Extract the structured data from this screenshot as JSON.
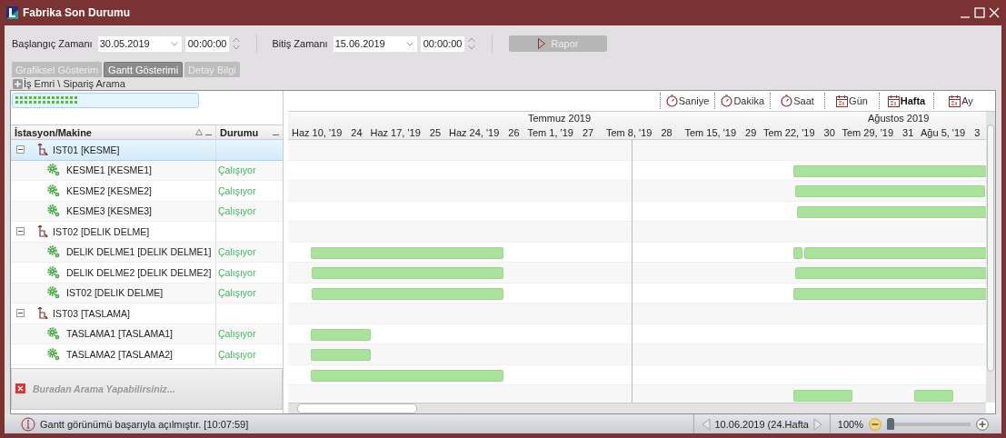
{
  "window": {
    "title": "Fabrika Son Durumu"
  },
  "filters": {
    "start_label": "Başlangıç Zamanı",
    "start_date": "30.05.2019",
    "start_time": "00:00:00",
    "end_label": "Bitiş Zamanı",
    "end_date": "15.06.2019",
    "end_time": "00:00:00",
    "report_button": "Rapor",
    "report_disabled": true
  },
  "tabs": [
    {
      "label": "Grafiksel Gösterim",
      "selected": false
    },
    {
      "label": "Gantt Gösterimi",
      "selected": true
    },
    {
      "label": "Detay Bilgi",
      "selected": false
    }
  ],
  "search_toggle": {
    "label": "İş Emri \\ Sipariş Arama",
    "expanded": false
  },
  "scale_buttons": [
    {
      "label": "Saniye",
      "kind": "clock",
      "selected": false
    },
    {
      "label": "Dakika",
      "kind": "clock",
      "selected": false
    },
    {
      "label": "Saat",
      "kind": "clock",
      "selected": false
    },
    {
      "label": "Gün",
      "kind": "calendar",
      "selected": false
    },
    {
      "label": "Hafta",
      "kind": "calendar",
      "selected": true
    },
    {
      "label": "Ay",
      "kind": "calendar",
      "selected": false
    }
  ],
  "grid": {
    "columns": [
      "İstasyon/Makine",
      "Durumu"
    ],
    "stations": [
      {
        "name": "IST01 [KESME]",
        "expanded": true,
        "selected": true,
        "children": [
          {
            "name": "KESME1 [KESME1]",
            "status": "Çalışıyor",
            "selected": false
          },
          {
            "name": "KESME2 [KESME2]",
            "status": "Çalışıyor",
            "selected": false
          },
          {
            "name": "KESME3 [KESME3]",
            "status": "Çalışıyor",
            "selected": false
          }
        ]
      },
      {
        "name": "IST02 [DELIK DELME]",
        "expanded": true,
        "selected": false,
        "children": [
          {
            "name": "DELIK DELME1 [DELIK DELME1]",
            "status": "Çalışıyor",
            "selected": false
          },
          {
            "name": "DELIK DELME2 [DELIK DELME2]",
            "status": "Çalışıyor",
            "selected": false
          },
          {
            "name": "IST02 [DELIK DELME]",
            "status": "Çalışıyor",
            "selected": false
          }
        ]
      },
      {
        "name": "IST03 [TASLAMA]",
        "expanded": true,
        "selected": false,
        "children": [
          {
            "name": "TASLAMA1 [TASLAMA1]",
            "status": "Çalışıyor",
            "selected": false
          },
          {
            "name": "TASLAMA2 [TASLAMA2]",
            "status": "Çalışıyor",
            "selected": false
          }
        ]
      }
    ]
  },
  "filter_panel": {
    "placeholder": "Buradan Arama Yapabilirsiniz..."
  },
  "timeline": {
    "months": [
      "Temmuz 2019",
      "Ağustos 2019"
    ],
    "weeks": [
      {
        "label": "Haz 10, '19",
        "number": "24"
      },
      {
        "label": "Haz 17, '19",
        "number": "25"
      },
      {
        "label": "Haz 24, '19",
        "number": "26"
      },
      {
        "label": "Tem 1, '19",
        "number": "27"
      },
      {
        "label": "Tem 8, '19",
        "number": "28"
      },
      {
        "label": "Tem 15, '19",
        "number": "29"
      },
      {
        "label": "Tem 22, '19",
        "number": "30"
      },
      {
        "label": "Tem 29, '19",
        "number": "31"
      },
      {
        "label": "Ağu 5, '19",
        "number": "3"
      }
    ]
  },
  "status_bar": {
    "message": "Gantt görünümü başarıyla açılmıştır. [10:07:59]",
    "date": "10.06.2019 (24.Hafta",
    "zoom": "100%",
    "zoom_slider": {
      "level": 0
    }
  }
}
